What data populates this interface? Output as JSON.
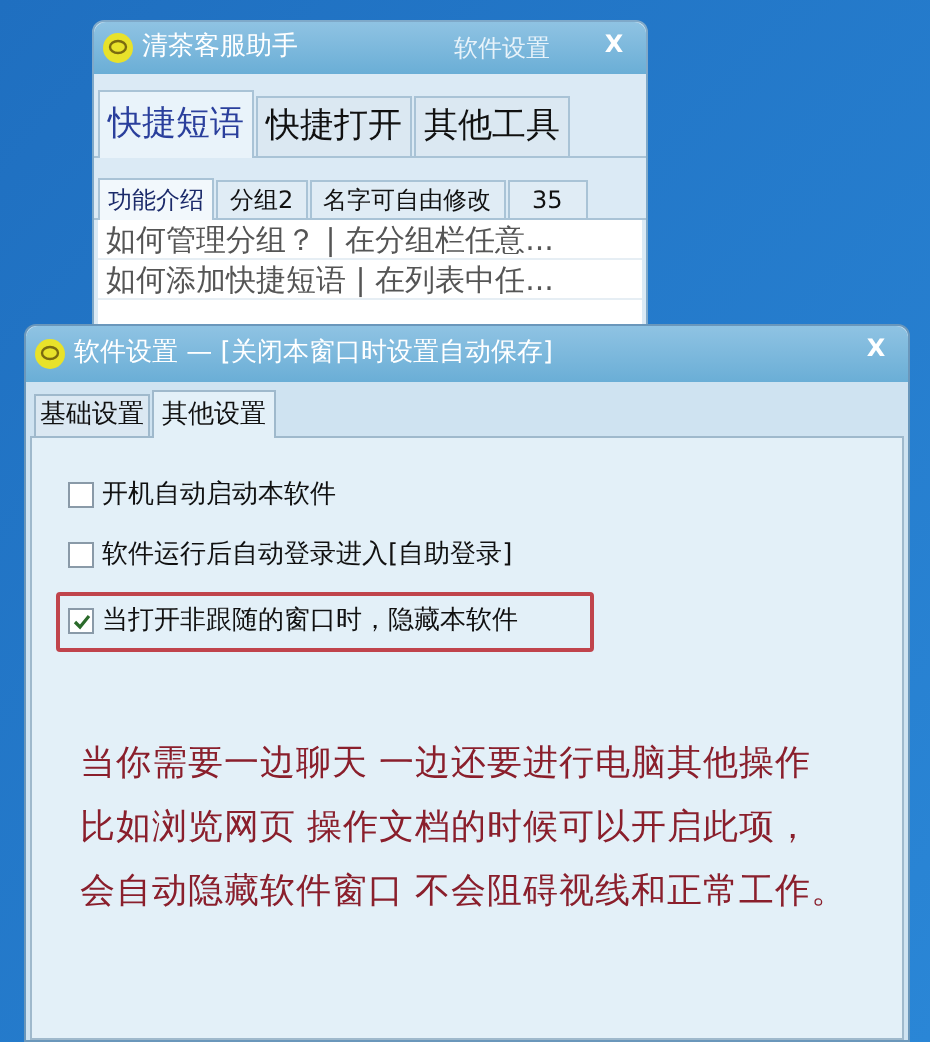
{
  "back_window": {
    "title": "清茶客服助手",
    "settings_link": "软件设置",
    "close": "X",
    "tabs": [
      {
        "label": "快捷短语",
        "selected": true
      },
      {
        "label": "快捷打开",
        "selected": false
      },
      {
        "label": "其他工具",
        "selected": false
      }
    ],
    "sub_tabs": [
      {
        "label": "功能介绍",
        "selected": true
      },
      {
        "label": "分组2",
        "selected": false
      },
      {
        "label": "名字可自由修改",
        "selected": false
      },
      {
        "label": "35",
        "selected": false
      }
    ],
    "phrases": [
      "如何管理分组？ | 在分组栏任意...",
      "如何添加快捷短语 | 在列表中任..."
    ]
  },
  "settings_window": {
    "title": "软件设置 — [关闭本窗口时设置自动保存]",
    "close": "X",
    "tabs": [
      {
        "label": "基础设置",
        "selected": false
      },
      {
        "label": "其他设置",
        "selected": true
      }
    ],
    "options": [
      {
        "label": "开机自动启动本软件",
        "checked": false,
        "highlighted": false
      },
      {
        "label": "软件运行后自动登录进入[自助登录]",
        "checked": false,
        "highlighted": false
      },
      {
        "label": "当打开非跟随的窗口时，隐藏本软件",
        "checked": true,
        "highlighted": true
      }
    ],
    "note_lines": [
      "当你需要一边聊天 一边还要进行电脑其他操作",
      "比如浏览网页 操作文档的时候可以开启此项，",
      "会自动隐藏软件窗口 不会阻碍视线和正常工作。"
    ]
  }
}
